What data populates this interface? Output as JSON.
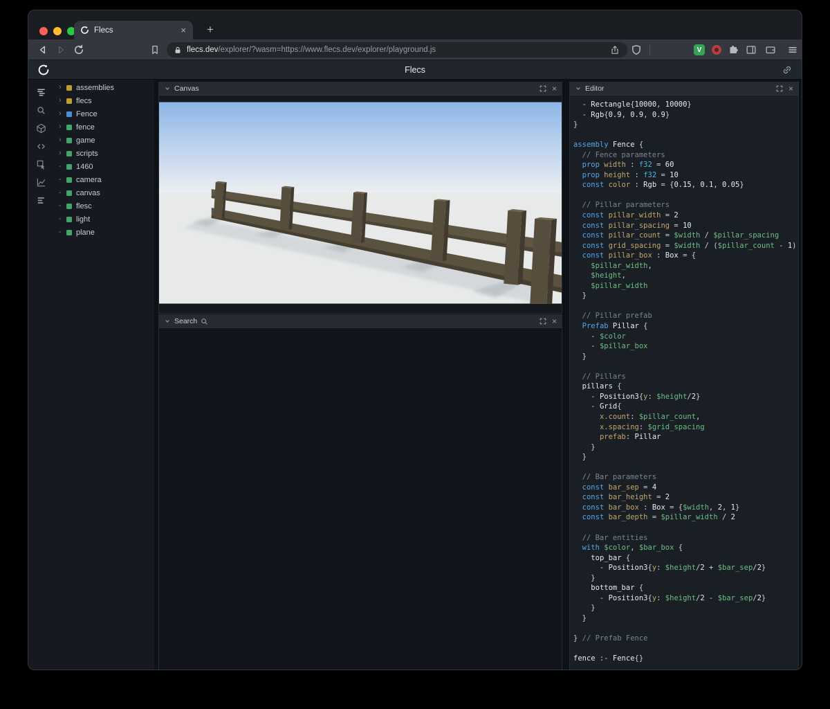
{
  "browser": {
    "tab_title": "Flecs",
    "close_tab_glyph": "×",
    "new_tab_glyph": "+",
    "url_host": "flecs.dev",
    "url_path": "/explorer/?wasm=https://www.flecs.dev/explorer/playground.js",
    "ext_v_label": "V",
    "window_controls": [
      "close-window-button",
      "minimize-window-button",
      "zoom-window-button"
    ],
    "toolbar_icons": [
      "back-icon",
      "forward-icon",
      "reload-icon",
      "bookmark-icon",
      "lock-icon",
      "share-icon",
      "brave-shield-icon",
      "extension-v-icon",
      "extension-red-icon",
      "extensions-puzzle-icon",
      "side-panel-icon",
      "wallet-icon",
      "menu-icon"
    ]
  },
  "page": {
    "title": "Flecs"
  },
  "sidebar": {
    "icons": [
      {
        "name": "outliner-icon",
        "active": true
      },
      {
        "name": "search-icon",
        "active": false
      },
      {
        "name": "entities-icon",
        "active": false
      },
      {
        "name": "code-icon",
        "active": false
      },
      {
        "name": "inspect-icon",
        "active": false
      },
      {
        "name": "chart-icon",
        "active": false
      },
      {
        "name": "stats-icon",
        "active": false
      }
    ]
  },
  "tree": {
    "items": [
      {
        "label": "assemblies",
        "marker": "›",
        "expandable": true,
        "kind": "module",
        "color": "#bd9e32"
      },
      {
        "label": "flecs",
        "marker": "›",
        "expandable": true,
        "kind": "module",
        "color": "#bd9e32"
      },
      {
        "label": "Fence",
        "marker": "›",
        "expandable": true,
        "kind": "prefab",
        "color": "#4a8fd8"
      },
      {
        "label": "fence",
        "marker": "›",
        "expandable": true,
        "kind": "entity",
        "color": "#44a369"
      },
      {
        "label": "game",
        "marker": "›",
        "expandable": true,
        "kind": "entity",
        "color": "#44a369"
      },
      {
        "label": "scripts",
        "marker": "›",
        "expandable": true,
        "kind": "entity",
        "color": "#44a369"
      },
      {
        "label": "1460",
        "marker": "-",
        "expandable": false,
        "kind": "entity",
        "color": "#44a369"
      },
      {
        "label": "camera",
        "marker": "-",
        "expandable": false,
        "kind": "entity",
        "color": "#44a369"
      },
      {
        "label": "canvas",
        "marker": "-",
        "expandable": false,
        "kind": "entity",
        "color": "#44a369"
      },
      {
        "label": "flesc",
        "marker": "-",
        "expandable": false,
        "kind": "entity",
        "color": "#44a369"
      },
      {
        "label": "light",
        "marker": "-",
        "expandable": false,
        "kind": "entity",
        "color": "#44a369"
      },
      {
        "label": "plane",
        "marker": "-",
        "expandable": false,
        "kind": "entity",
        "color": "#44a369"
      }
    ]
  },
  "panels": {
    "close_glyph": "×",
    "canvas": {
      "title": "Canvas"
    },
    "search": {
      "title": "Search"
    },
    "editor": {
      "title": "Editor"
    }
  },
  "editor": {
    "lines": [
      [
        [
          "p",
          "  - "
        ],
        [
          "e",
          "Rectangle"
        ],
        [
          "p",
          "{"
        ],
        [
          "n",
          "10000"
        ],
        [
          "p",
          ", "
        ],
        [
          "n",
          "10000"
        ],
        [
          "p",
          "}"
        ]
      ],
      [
        [
          "p",
          "  - "
        ],
        [
          "e",
          "Rgb"
        ],
        [
          "p",
          "{"
        ],
        [
          "n",
          "0.9"
        ],
        [
          "p",
          ", "
        ],
        [
          "n",
          "0.9"
        ],
        [
          "p",
          ", "
        ],
        [
          "n",
          "0.9"
        ],
        [
          "p",
          "}"
        ]
      ],
      [
        [
          "p",
          "}"
        ]
      ],
      [],
      [
        [
          "k",
          "assembly"
        ],
        [
          "p",
          " "
        ],
        [
          "e",
          "Fence"
        ],
        [
          "p",
          " {"
        ]
      ],
      [
        [
          "c",
          "  // Fence parameters"
        ]
      ],
      [
        [
          "p",
          "  "
        ],
        [
          "k",
          "prop"
        ],
        [
          "p",
          " "
        ],
        [
          "d",
          "width"
        ],
        [
          "p",
          " : "
        ],
        [
          "t",
          "f32"
        ],
        [
          "p",
          " = "
        ],
        [
          "n",
          "60"
        ]
      ],
      [
        [
          "p",
          "  "
        ],
        [
          "k",
          "prop"
        ],
        [
          "p",
          " "
        ],
        [
          "d",
          "height"
        ],
        [
          "p",
          " : "
        ],
        [
          "t",
          "f32"
        ],
        [
          "p",
          " = "
        ],
        [
          "n",
          "10"
        ]
      ],
      [
        [
          "p",
          "  "
        ],
        [
          "k",
          "const"
        ],
        [
          "p",
          " "
        ],
        [
          "d",
          "color"
        ],
        [
          "p",
          " : "
        ],
        [
          "e",
          "Rgb"
        ],
        [
          "p",
          " = {"
        ],
        [
          "n",
          "0.15"
        ],
        [
          "p",
          ", "
        ],
        [
          "n",
          "0.1"
        ],
        [
          "p",
          ", "
        ],
        [
          "n",
          "0.05"
        ],
        [
          "p",
          "}"
        ]
      ],
      [],
      [
        [
          "c",
          "  // Pillar parameters"
        ]
      ],
      [
        [
          "p",
          "  "
        ],
        [
          "k",
          "const"
        ],
        [
          "p",
          " "
        ],
        [
          "d",
          "pillar_width"
        ],
        [
          "p",
          " = "
        ],
        [
          "n",
          "2"
        ]
      ],
      [
        [
          "p",
          "  "
        ],
        [
          "k",
          "const"
        ],
        [
          "p",
          " "
        ],
        [
          "d",
          "pillar_spacing"
        ],
        [
          "p",
          " = "
        ],
        [
          "n",
          "10"
        ]
      ],
      [
        [
          "p",
          "  "
        ],
        [
          "k",
          "const"
        ],
        [
          "p",
          " "
        ],
        [
          "d",
          "pillar_count"
        ],
        [
          "p",
          " = "
        ],
        [
          "v",
          "$width"
        ],
        [
          "p",
          " / "
        ],
        [
          "v",
          "$pillar_spacing"
        ]
      ],
      [
        [
          "p",
          "  "
        ],
        [
          "k",
          "const"
        ],
        [
          "p",
          " "
        ],
        [
          "d",
          "grid_spacing"
        ],
        [
          "p",
          " = "
        ],
        [
          "v",
          "$width"
        ],
        [
          "p",
          " / ("
        ],
        [
          "v",
          "$pillar_count"
        ],
        [
          "p",
          " - "
        ],
        [
          "n",
          "1"
        ],
        [
          "p",
          ")"
        ]
      ],
      [
        [
          "p",
          "  "
        ],
        [
          "k",
          "const"
        ],
        [
          "p",
          " "
        ],
        [
          "d",
          "pillar_box"
        ],
        [
          "p",
          " : "
        ],
        [
          "e",
          "Box"
        ],
        [
          "p",
          " = {"
        ]
      ],
      [
        [
          "p",
          "    "
        ],
        [
          "v",
          "$pillar_width"
        ],
        [
          "p",
          ","
        ]
      ],
      [
        [
          "p",
          "    "
        ],
        [
          "v",
          "$height"
        ],
        [
          "p",
          ","
        ]
      ],
      [
        [
          "p",
          "    "
        ],
        [
          "v",
          "$pillar_width"
        ]
      ],
      [
        [
          "p",
          "  }"
        ]
      ],
      [],
      [
        [
          "c",
          "  // Pillar prefab"
        ]
      ],
      [
        [
          "p",
          "  "
        ],
        [
          "k",
          "Prefab"
        ],
        [
          "p",
          " "
        ],
        [
          "e",
          "Pillar"
        ],
        [
          "p",
          " {"
        ]
      ],
      [
        [
          "p",
          "    - "
        ],
        [
          "v",
          "$color"
        ]
      ],
      [
        [
          "p",
          "    - "
        ],
        [
          "v",
          "$pillar_box"
        ]
      ],
      [
        [
          "p",
          "  }"
        ]
      ],
      [],
      [
        [
          "c",
          "  // Pillars"
        ]
      ],
      [
        [
          "p",
          "  "
        ],
        [
          "e",
          "pillars"
        ],
        [
          "p",
          " {"
        ]
      ],
      [
        [
          "p",
          "    - "
        ],
        [
          "e",
          "Position3"
        ],
        [
          "p",
          "{"
        ],
        [
          "d",
          "y"
        ],
        [
          "p",
          ": "
        ],
        [
          "v",
          "$height"
        ],
        [
          "p",
          "/"
        ],
        [
          "n",
          "2"
        ],
        [
          "p",
          "}"
        ]
      ],
      [
        [
          "p",
          "    - "
        ],
        [
          "e",
          "Grid"
        ],
        [
          "p",
          "{"
        ]
      ],
      [
        [
          "p",
          "      "
        ],
        [
          "d",
          "x.count"
        ],
        [
          "p",
          ": "
        ],
        [
          "v",
          "$pillar_count"
        ],
        [
          "p",
          ","
        ]
      ],
      [
        [
          "p",
          "      "
        ],
        [
          "d",
          "x.spacing"
        ],
        [
          "p",
          ": "
        ],
        [
          "v",
          "$grid_spacing"
        ]
      ],
      [
        [
          "p",
          "      "
        ],
        [
          "d",
          "prefab"
        ],
        [
          "p",
          ": "
        ],
        [
          "e",
          "Pillar"
        ]
      ],
      [
        [
          "p",
          "    }"
        ]
      ],
      [
        [
          "p",
          "  }"
        ]
      ],
      [],
      [
        [
          "c",
          "  // Bar parameters"
        ]
      ],
      [
        [
          "p",
          "  "
        ],
        [
          "k",
          "const"
        ],
        [
          "p",
          " "
        ],
        [
          "d",
          "bar_sep"
        ],
        [
          "p",
          " = "
        ],
        [
          "n",
          "4"
        ]
      ],
      [
        [
          "p",
          "  "
        ],
        [
          "k",
          "const"
        ],
        [
          "p",
          " "
        ],
        [
          "d",
          "bar_height"
        ],
        [
          "p",
          " = "
        ],
        [
          "n",
          "2"
        ]
      ],
      [
        [
          "p",
          "  "
        ],
        [
          "k",
          "const"
        ],
        [
          "p",
          " "
        ],
        [
          "d",
          "bar_box"
        ],
        [
          "p",
          " : "
        ],
        [
          "e",
          "Box"
        ],
        [
          "p",
          " = {"
        ],
        [
          "v",
          "$width"
        ],
        [
          "p",
          ", "
        ],
        [
          "n",
          "2"
        ],
        [
          "p",
          ", "
        ],
        [
          "n",
          "1"
        ],
        [
          "p",
          "}"
        ]
      ],
      [
        [
          "p",
          "  "
        ],
        [
          "k",
          "const"
        ],
        [
          "p",
          " "
        ],
        [
          "d",
          "bar_depth"
        ],
        [
          "p",
          " = "
        ],
        [
          "v",
          "$pillar_width"
        ],
        [
          "p",
          " / "
        ],
        [
          "n",
          "2"
        ]
      ],
      [],
      [
        [
          "c",
          "  // Bar entities"
        ]
      ],
      [
        [
          "p",
          "  "
        ],
        [
          "k",
          "with"
        ],
        [
          "p",
          " "
        ],
        [
          "v",
          "$color"
        ],
        [
          "p",
          ", "
        ],
        [
          "v",
          "$bar_box"
        ],
        [
          "p",
          " {"
        ]
      ],
      [
        [
          "p",
          "    "
        ],
        [
          "e",
          "top_bar"
        ],
        [
          "p",
          " {"
        ]
      ],
      [
        [
          "p",
          "      - "
        ],
        [
          "e",
          "Position3"
        ],
        [
          "p",
          "{"
        ],
        [
          "d",
          "y"
        ],
        [
          "p",
          ": "
        ],
        [
          "v",
          "$height"
        ],
        [
          "p",
          "/"
        ],
        [
          "n",
          "2"
        ],
        [
          "p",
          " + "
        ],
        [
          "v",
          "$bar_sep"
        ],
        [
          "p",
          "/"
        ],
        [
          "n",
          "2"
        ],
        [
          "p",
          "}"
        ]
      ],
      [
        [
          "p",
          "    }"
        ]
      ],
      [
        [
          "p",
          "    "
        ],
        [
          "e",
          "bottom_bar"
        ],
        [
          "p",
          " {"
        ]
      ],
      [
        [
          "p",
          "      - "
        ],
        [
          "e",
          "Position3"
        ],
        [
          "p",
          "{"
        ],
        [
          "d",
          "y"
        ],
        [
          "p",
          ": "
        ],
        [
          "v",
          "$height"
        ],
        [
          "p",
          "/"
        ],
        [
          "n",
          "2"
        ],
        [
          "p",
          " - "
        ],
        [
          "v",
          "$bar_sep"
        ],
        [
          "p",
          "/"
        ],
        [
          "n",
          "2"
        ],
        [
          "p",
          "}"
        ]
      ],
      [
        [
          "p",
          "    }"
        ]
      ],
      [
        [
          "p",
          "  }"
        ]
      ],
      [],
      [
        [
          "p",
          "} "
        ],
        [
          "c",
          "// Prefab Fence"
        ]
      ],
      [],
      [
        [
          "e",
          "fence"
        ],
        [
          "p",
          " :- "
        ],
        [
          "e",
          "Fence"
        ],
        [
          "p",
          "{}"
        ]
      ]
    ]
  },
  "colors": {
    "module_square": "#bd9e32",
    "prefab_square": "#4a8fd8",
    "entity_square": "#44a369",
    "code_keyword": "#55a7e8",
    "code_type": "#4fb6e3",
    "code_decl_name": "#c2a76c",
    "code_variable": "#6dbe85",
    "code_comment": "#7b8690",
    "sky_top": "#8db5e6",
    "ground": "#e8eaea",
    "fence_wood": "#574d3d"
  }
}
